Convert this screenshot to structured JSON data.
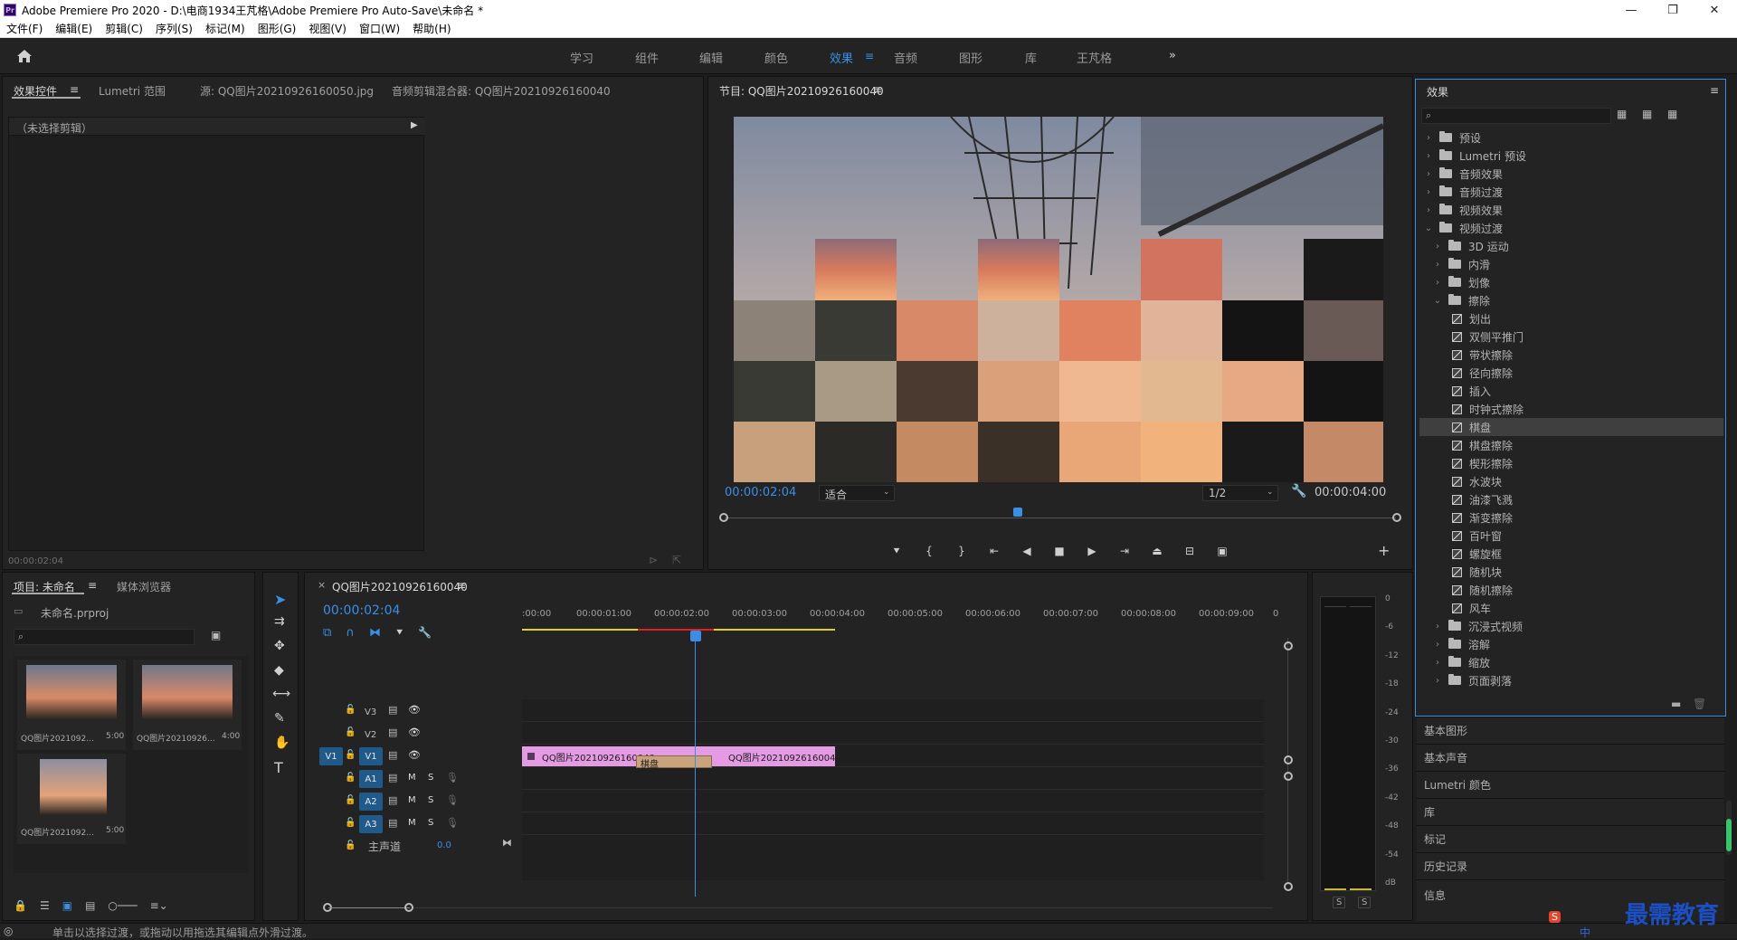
{
  "titlebar": {
    "app_badge": "Pr",
    "title": "Adobe Premiere Pro 2020 - D:\\电商1934王芃格\\Adobe Premiere Pro Auto-Save\\未命名 *",
    "minimize": "—",
    "restore": "❐",
    "close": "✕"
  },
  "menu": [
    "文件(F)",
    "编辑(E)",
    "剪辑(C)",
    "序列(S)",
    "标记(M)",
    "图形(G)",
    "视图(V)",
    "窗口(W)",
    "帮助(H)"
  ],
  "workspace": {
    "tabs": [
      "学习",
      "组件",
      "编辑",
      "颜色",
      "效果",
      "音频",
      "图形",
      "库",
      "王芃格"
    ],
    "active": "效果",
    "more": "»"
  },
  "source_panel": {
    "tabs": [
      "效果控件",
      "Lumetri 范围",
      "源: QQ图片20210926160050.jpg",
      "音频剪辑混合器: QQ图片20210926160040"
    ],
    "no_clip": "（未选择剪辑）",
    "timecode": "00:00:02:04"
  },
  "program_monitor": {
    "title": "节目: QQ图片20210926160040",
    "timecode_current": "00:00:02:04",
    "fit": "适合",
    "resolution": "1/2",
    "timecode_duration": "00:00:04:00"
  },
  "project_panel": {
    "tabs": [
      "项目: 未命名",
      "媒体浏览器"
    ],
    "file": "未命名.prproj",
    "items": [
      {
        "name": "QQ图片2021092...",
        "duration": "5:00"
      },
      {
        "name": "QQ图片20210926...",
        "duration": "4:00"
      },
      {
        "name": "QQ图片2021092...",
        "duration": "5:00"
      }
    ]
  },
  "timeline": {
    "title": "QQ图片20210926160040",
    "timecode": "00:00:02:04",
    "ruler": [
      ":00:00",
      "00:00:01:00",
      "00:00:02:00",
      "00:00:03:00",
      "00:00:04:00",
      "00:00:05:00",
      "00:00:06:00",
      "00:00:07:00",
      "00:00:08:00",
      "00:00:09:00",
      "0"
    ],
    "video_tracks": [
      "V3",
      "V2",
      "V1"
    ],
    "audio_tracks": [
      "A1",
      "A2",
      "A3"
    ],
    "source_target_v": "V1",
    "master": "主声道",
    "master_value": "0.0",
    "clip_left": "QQ图片20210926160040",
    "clip_right": "QQ图片20210926160040",
    "transition": "棋盘",
    "mute": "M",
    "solo": "S"
  },
  "meter": {
    "scale": [
      "0",
      "-6",
      "-12",
      "-18",
      "-24",
      "-30",
      "-36",
      "-42",
      "-48",
      "-54",
      "dB"
    ],
    "solo_left": "S",
    "solo_right": "S"
  },
  "effects_panel": {
    "title": "效果",
    "search_placeholder": "",
    "tree": [
      {
        "label": "预设",
        "type": "folder",
        "level": 0,
        "open": false
      },
      {
        "label": "Lumetri 预设",
        "type": "folder",
        "level": 0,
        "open": false
      },
      {
        "label": "音频效果",
        "type": "folder",
        "level": 0,
        "open": false
      },
      {
        "label": "音频过渡",
        "type": "folder",
        "level": 0,
        "open": false
      },
      {
        "label": "视频效果",
        "type": "folder",
        "level": 0,
        "open": false
      },
      {
        "label": "视频过渡",
        "type": "folder",
        "level": 0,
        "open": true
      },
      {
        "label": "3D 运动",
        "type": "folder",
        "level": 1,
        "open": false
      },
      {
        "label": "内滑",
        "type": "folder",
        "level": 1,
        "open": false
      },
      {
        "label": "划像",
        "type": "folder",
        "level": 1,
        "open": false
      },
      {
        "label": "擦除",
        "type": "folder",
        "level": 1,
        "open": true
      },
      {
        "label": "划出",
        "type": "fx",
        "level": 2
      },
      {
        "label": "双侧平推门",
        "type": "fx",
        "level": 2
      },
      {
        "label": "带状擦除",
        "type": "fx",
        "level": 2
      },
      {
        "label": "径向擦除",
        "type": "fx",
        "level": 2
      },
      {
        "label": "插入",
        "type": "fx",
        "level": 2
      },
      {
        "label": "时钟式擦除",
        "type": "fx",
        "level": 2
      },
      {
        "label": "棋盘",
        "type": "fx",
        "level": 2,
        "selected": true
      },
      {
        "label": "棋盘擦除",
        "type": "fx",
        "level": 2
      },
      {
        "label": "楔形擦除",
        "type": "fx",
        "level": 2
      },
      {
        "label": "水波块",
        "type": "fx",
        "level": 2
      },
      {
        "label": "油漆飞溅",
        "type": "fx",
        "level": 2
      },
      {
        "label": "渐变擦除",
        "type": "fx",
        "level": 2
      },
      {
        "label": "百叶窗",
        "type": "fx",
        "level": 2
      },
      {
        "label": "螺旋框",
        "type": "fx",
        "level": 2
      },
      {
        "label": "随机块",
        "type": "fx",
        "level": 2
      },
      {
        "label": "随机擦除",
        "type": "fx",
        "level": 2
      },
      {
        "label": "风车",
        "type": "fx",
        "level": 2
      },
      {
        "label": "沉浸式视频",
        "type": "folder",
        "level": 1,
        "open": false
      },
      {
        "label": "溶解",
        "type": "folder",
        "level": 1,
        "open": false
      },
      {
        "label": "缩放",
        "type": "folder",
        "level": 1,
        "open": false
      },
      {
        "label": "页面剥落",
        "type": "folder",
        "level": 1,
        "open": false
      }
    ]
  },
  "right_stack": [
    "基本图形",
    "基本声音",
    "Lumetri 颜色",
    "库",
    "标记",
    "历史记录",
    "信息"
  ],
  "status_bar": {
    "message": "单击以选择过渡，或拖动以用拖选其编辑点外滑过渡。",
    "watermark": "最需教育",
    "ime": "中"
  },
  "colors": {
    "accent": "#3a8ee6",
    "clip": "#e59ae4",
    "transition": "#c9a37c",
    "playhead": "#3a8ee6"
  }
}
